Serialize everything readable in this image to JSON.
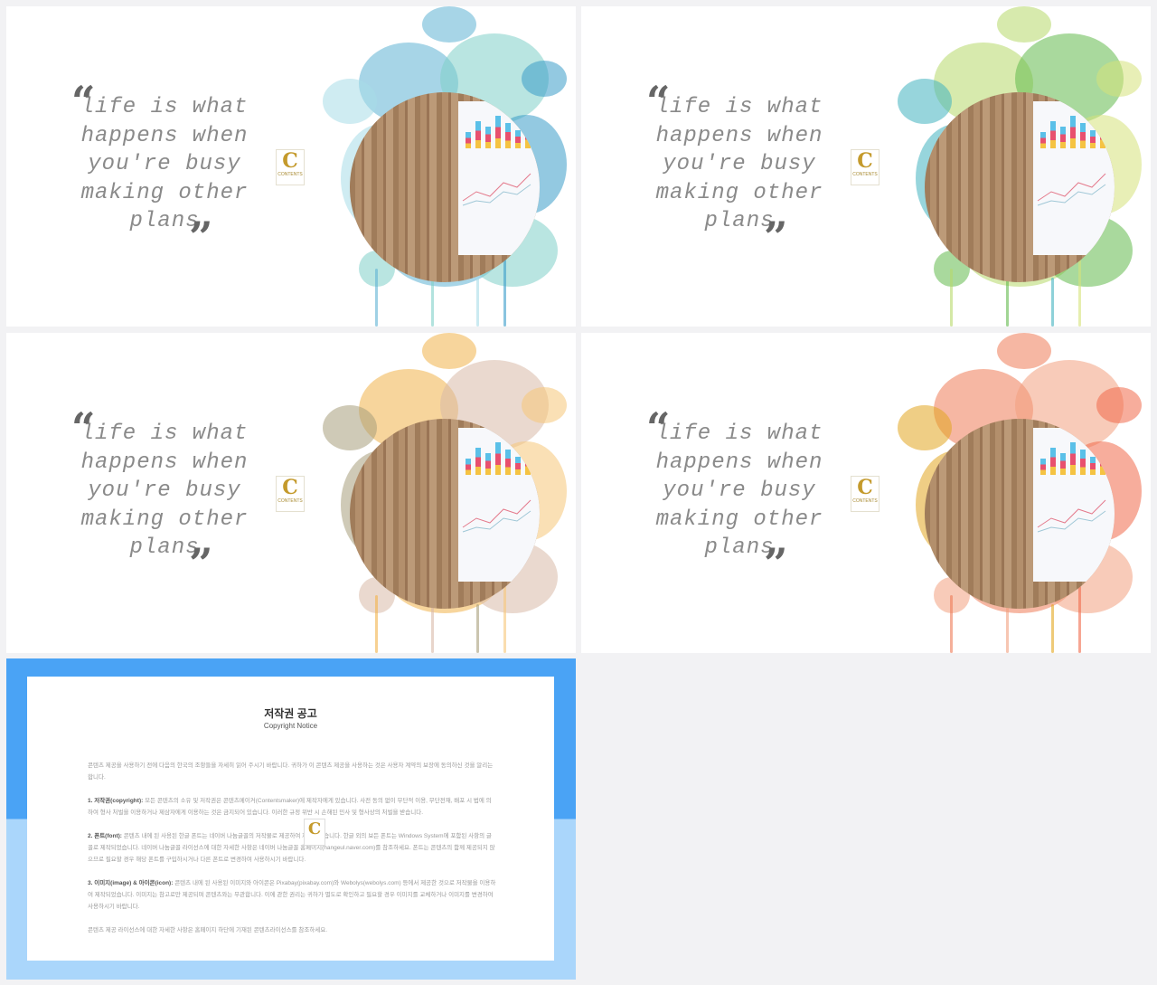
{
  "slides": [
    {
      "quote": "life is what happens when you're busy making other plans",
      "palette": [
        "#5fb3d3",
        "#7fd0c8",
        "#a8dce8",
        "#3a9cc9"
      ]
    },
    {
      "quote": "life is what happens when you're busy making other plans",
      "palette": [
        "#b7d86a",
        "#63b94d",
        "#42b3c0",
        "#d6e27a"
      ]
    },
    {
      "quote": "life is what happens when you're busy making other plans",
      "palette": [
        "#f1b34a",
        "#d9b9a8",
        "#a89f7c",
        "#f6c779"
      ]
    },
    {
      "quote": "life is what happens when you're busy making other plans",
      "palette": [
        "#ee7b57",
        "#f2a07f",
        "#e2a620",
        "#f06a4b"
      ]
    }
  ],
  "quote_marks": {
    "open": "“",
    "close": "”"
  },
  "logo": {
    "letter": "C",
    "text": "CONTENTS"
  },
  "notice": {
    "title": "저작권 공고",
    "subtitle": "Copyright Notice",
    "intro": "콘텐츠 제공을 사용하기 전에 다음의 한국의 조항들을 자세히 읽어 주시기 바랍니다. 귀하가 이 콘텐츠 제공을 사용하는 것은 사용자 계약의 보장에 동의하신 것을 알리는 합니다.",
    "sections": [
      {
        "label": "1. 저작권(copyright):",
        "text": " 모든 콘텐츠의 소유 및 저작권은 콘텐츠메이커(Contentsmaker)에 제작자에게 있습니다. 사전 동의 없이 무단적 이용, 무단전재, 배포 시 법에 의하여 형사 처벌을 이용하거나 제삼자에게 이용하는 것은 금지되어 있습니다. 이러한 규정 위반 시 손해된 민사 및 형사상의 처벌을 받습니다."
      },
      {
        "label": "2. 폰트(font):",
        "text": " 콘텐츠 내에 된 사용된 한글 폰트는 네이버 나눔글꼴의 저작물로 제공하여 제작되었습니다. 한글 외의 보든 폰트는 Windows System에 포함된 사항의 글꼴로 제작되었습니다. 네이버 나눔글꼴 라이선스에 대한 자세한 사항은 네이버 나눔글꼴 홈페이지(hangeul.naver.com)를 참조하세요. 폰트는 콘텐츠의 함께 제공되지 않으므로 필요할 경우 해당 폰트를 구입하시거나 다른 폰트로 변경하여 사용하시기 바랍니다."
      },
      {
        "label": "3. 이미지(image) & 아이콘(icon):",
        "text": " 콘텐츠 내에 된 사용된 이미지와 아이콘은 Pixabay(pixabay.com)와 Webolys(webolys.com) 등에서 제공한 것으로 저작물을 이용하여 제작되었습니다. 이미지는 참고로만 제공되며 콘텐츠와는 무관합니다. 이에 관한 권리는 귀하가 별도로 확인하고 필요할 경우 이미지를 교체하거나 이미지를 변경하여 사용하시기 바랍니다."
      }
    ],
    "footer": "콘텐츠 제공 라이선스에 대한 자세한 사항은 홈페이지 하단에 기재된 콘텐츠라이선스를 참조하세요.",
    "colors": {
      "top": "#4aa3f5",
      "bottom": "#aad6fb"
    }
  }
}
